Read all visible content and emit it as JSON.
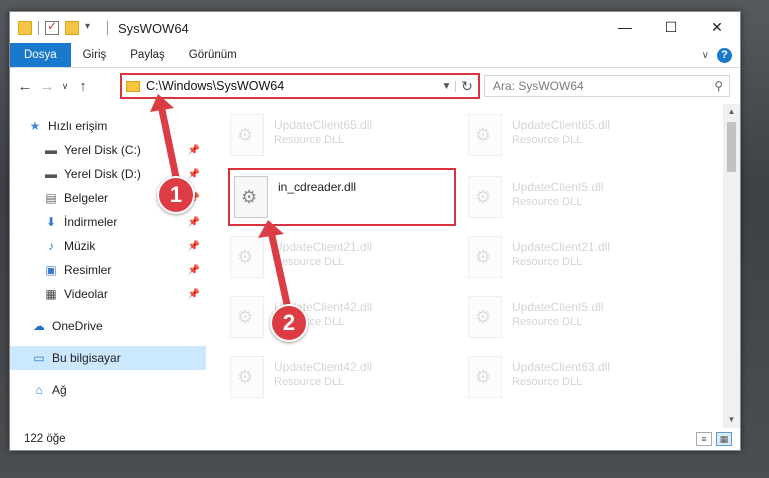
{
  "window": {
    "title": "SysWOW64",
    "minimize": "—",
    "maximize": "☐",
    "close": "✕"
  },
  "ribbon": {
    "tabs": [
      "Dosya",
      "Giriş",
      "Paylaş",
      "Görünüm"
    ],
    "expand": "∨",
    "help": "?"
  },
  "address": {
    "back": "←",
    "forward": "→",
    "recent": "∨",
    "up": "↑",
    "path": "C:\\Windows\\SysWOW64",
    "refresh": "↻",
    "search_placeholder": "Ara: SysWOW64"
  },
  "sidebar": {
    "items": [
      {
        "label": "Hızlı erişim",
        "icon": "star-icon"
      },
      {
        "label": "Yerel Disk (C:)",
        "icon": "drive-icon",
        "pinned": true
      },
      {
        "label": "Yerel Disk (D:)",
        "icon": "drive-icon",
        "pinned": true
      },
      {
        "label": "Belgeler",
        "icon": "document-icon",
        "pinned": true
      },
      {
        "label": "İndirmeler",
        "icon": "download-icon",
        "pinned": true
      },
      {
        "label": "Müzik",
        "icon": "music-icon",
        "pinned": true
      },
      {
        "label": "Resimler",
        "icon": "pictures-icon",
        "pinned": true
      },
      {
        "label": "Videolar",
        "icon": "video-icon",
        "pinned": true
      },
      {
        "label": "OneDrive",
        "icon": "cloud-icon"
      },
      {
        "label": "Bu bilgisayar",
        "icon": "computer-icon",
        "selected": true
      },
      {
        "label": "Ağ",
        "icon": "network-icon"
      }
    ]
  },
  "files": {
    "selected": {
      "name": "in_cdreader.dll"
    },
    "ghost": [
      {
        "name": "UpdateClient65.dll",
        "type": "Resource DLL"
      },
      {
        "name": "UpdateClient65.dll",
        "type": "Resource DLL"
      },
      {
        "name": "UpdateClient5.dll",
        "type": "Resource DLL"
      },
      {
        "name": "UpdateClient21.dll",
        "type": "Resource DLL"
      },
      {
        "name": "UpdateClient21.dll",
        "type": "Resource DLL"
      },
      {
        "name": "UpdateClient42.dll",
        "type": "Resource DLL"
      },
      {
        "name": "UpdateClient5.dll",
        "type": "Resource DLL"
      },
      {
        "name": "UpdateClient42.dll",
        "type": "Resource DLL"
      },
      {
        "name": "UpdateClient63.dll",
        "type": "Resource DLL"
      }
    ]
  },
  "status": {
    "count": "122 öğe"
  },
  "callouts": {
    "one": "1",
    "two": "2"
  },
  "colors": {
    "accent": "#1979ca",
    "highlight": "#d9333f",
    "marker": "#dc3d44",
    "selection": "#cce8ff"
  }
}
